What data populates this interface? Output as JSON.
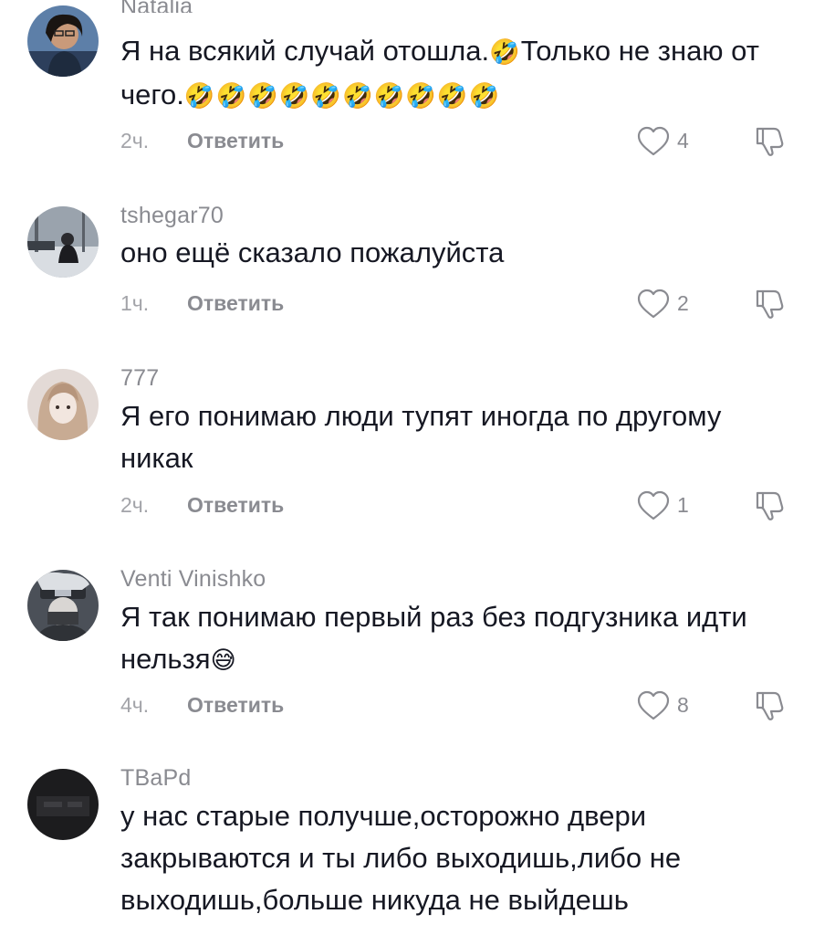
{
  "comments": [
    {
      "username": "Natalia",
      "text": "Я на всякий случай отошла.",
      "text_emoji": "🤣",
      "text_cont": "Только не знаю от чего.",
      "text_emoji_2": "🤣🤣🤣🤣🤣🤣🤣🤣🤣🤣",
      "time": "2ч.",
      "reply_label": "Ответить",
      "likes": "4"
    },
    {
      "username": "tshegar70",
      "text": "оно ещё сказало пожалуйста",
      "time": "1ч.",
      "reply_label": "Ответить",
      "likes": "2"
    },
    {
      "username": "777",
      "text": "Я его понимаю люди тупят иногда по другому никак",
      "time": "2ч.",
      "reply_label": "Ответить",
      "likes": "1"
    },
    {
      "username": "Venti Vinishko",
      "text": "Я так понимаю первый раз без подгузника идти нельзя",
      "text_emoji": "😅",
      "time": "4ч.",
      "reply_label": "Ответить",
      "likes": "8"
    },
    {
      "username": "TBaPd",
      "text": "у нас старые получше,осторожно двери закрываются и ты либо выходишь,либо не выходишь,больше никуда не выйдешь"
    }
  ],
  "icons": {
    "like": "heart-outline-icon",
    "dislike": "thumbs-down-icon"
  },
  "colors": {
    "text": "#161823",
    "secondary": "#8a8b91"
  }
}
